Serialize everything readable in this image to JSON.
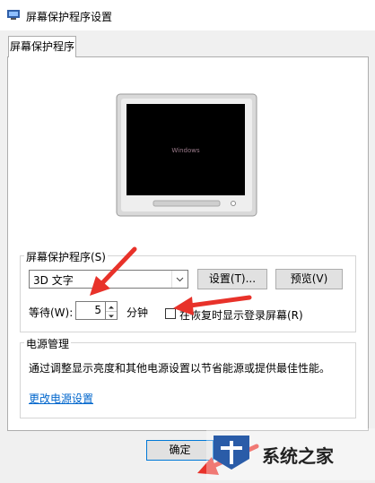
{
  "window": {
    "title": "屏幕保护程序设置"
  },
  "tabs": [
    {
      "label": "屏幕保护程序"
    }
  ],
  "monitor_preview": {
    "text": "Windows"
  },
  "screensaver_group": {
    "label": "屏幕保护程序(S)",
    "selected": "3D 文字",
    "settings_button": "设置(T)...",
    "preview_button": "预览(V)",
    "wait_label": "等待(W):",
    "wait_value": "5",
    "wait_unit": "分钟",
    "resume_checkbox_label": "在恢复时显示登录屏幕(R)",
    "resume_checked": false
  },
  "power_group": {
    "label": "电源管理",
    "description": "通过调整显示亮度和其他电源设置以节省能源或提供最佳性能。",
    "link": "更改电源设置"
  },
  "footer": {
    "ok_button": "确定"
  },
  "watermark": {
    "text": "系统之家"
  },
  "colors": {
    "accent": "#0078d7",
    "arrow": "#e8322a",
    "link": "#0066cc"
  }
}
